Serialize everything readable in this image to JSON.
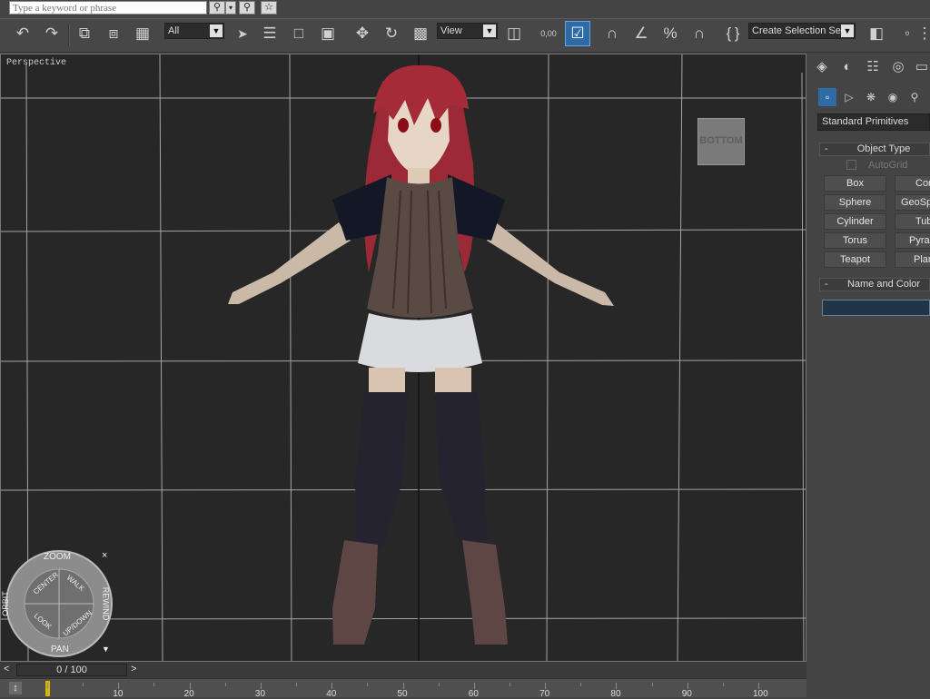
{
  "search": {
    "placeholder": "Type a keyword or phrase"
  },
  "toolbar": {
    "selection_filter": "All",
    "ref_coord": "View",
    "spinner_snap": "0,00",
    "named_selection_placeholder": "Create Selection Set"
  },
  "viewport": {
    "label": "Perspective",
    "viewcube_label": "BOTTOM",
    "wheel": {
      "zoom": "ZOOM",
      "orbit": "ORBIT",
      "rewind": "REWIND",
      "pan": "PAN",
      "center": "CENTER",
      "walk": "WALK",
      "look": "LOOK",
      "updown": "UP/DOWN"
    }
  },
  "command_panel": {
    "category": "Standard Primitives",
    "object_type": {
      "title": "Object Type",
      "collapse": "-",
      "autogrid": "AutoGrid",
      "buttons": [
        "Box",
        "Cone",
        "Sphere",
        "GeoSphere",
        "Cylinder",
        "Tube",
        "Torus",
        "Pyramid",
        "Teapot",
        "Plane"
      ]
    },
    "name_and_color": {
      "title": "Name and Color",
      "collapse": "-"
    }
  },
  "timeline": {
    "display": "0 / 100",
    "prev": "<",
    "next": ">",
    "ticks": [
      "10",
      "20",
      "30",
      "40",
      "50",
      "60",
      "70",
      "80",
      "90",
      "100"
    ]
  },
  "colors": {
    "accent": "#2e6aa4",
    "viewport_bg": "#272727",
    "grid": "#cfcfcf"
  }
}
